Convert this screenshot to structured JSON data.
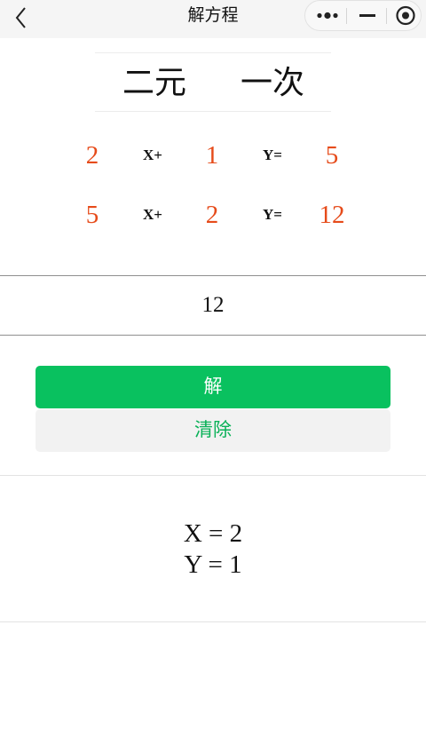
{
  "navbar": {
    "title": "解方程",
    "icons": {
      "back": "chevron-left-icon",
      "more": "more-dots-icon",
      "minimize": "minimize-icon",
      "close": "target-circle-icon"
    }
  },
  "mode": {
    "options": [
      "二元",
      "一次"
    ]
  },
  "equations": [
    {
      "a": "2",
      "x_label": "X+",
      "b": "1",
      "y_label": "Y=",
      "c": "5"
    },
    {
      "a": "5",
      "x_label": "X+",
      "b": "2",
      "y_label": "Y=",
      "c": "12"
    }
  ],
  "input": {
    "value": "12",
    "placeholder": ""
  },
  "buttons": {
    "solve": "解",
    "clear": "清除"
  },
  "result": {
    "x": "X = 2",
    "y": "Y = 1"
  },
  "colors": {
    "accent_green": "#09c15f",
    "coefficient": "#e64b1a",
    "navbar_bg": "#f5f5f5"
  }
}
